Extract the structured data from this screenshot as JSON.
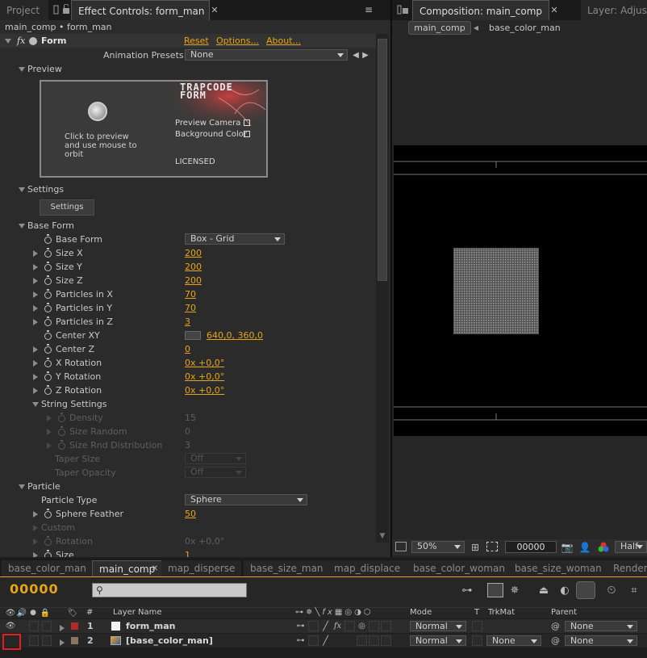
{
  "tabs_top": {
    "project": "Project",
    "effect_controls": "Effect Controls: form_man",
    "composition": "Composition: main_comp",
    "layer": "Layer: Adjustm"
  },
  "effect": {
    "breadcrumb": "main_comp • form_man",
    "fx_label": "fx",
    "name": "Form",
    "reset": "Reset",
    "options": "Options...",
    "about": "About...",
    "presets_label": "Animation Presets:",
    "presets_value": "None",
    "preview_label": "Preview",
    "preview_text": "Click to preview and use mouse to orbit",
    "logo": "TRAPCODE FORM",
    "preview_camera": "Preview Camera",
    "background_color": "Background Color",
    "licensed": "LICENSED",
    "settings_label": "Settings",
    "settings_button": "Settings",
    "base_form_label": "Base Form",
    "base_form": {
      "label": "Base Form",
      "value": "Box - Grid"
    },
    "size_x": {
      "label": "Size X",
      "value": "200"
    },
    "size_y": {
      "label": "Size Y",
      "value": "200"
    },
    "size_z": {
      "label": "Size Z",
      "value": "200"
    },
    "particles_x": {
      "label": "Particles in X",
      "value": "70"
    },
    "particles_y": {
      "label": "Particles in Y",
      "value": "70"
    },
    "particles_z": {
      "label": "Particles in Z",
      "value": "3"
    },
    "center_xy": {
      "label": "Center XY",
      "value": "640,0, 360,0"
    },
    "center_z": {
      "label": "Center Z",
      "value": "0"
    },
    "x_rotation": {
      "label": "X Rotation",
      "value": "0x +0,0°"
    },
    "y_rotation": {
      "label": "Y Rotation",
      "value": "0x +0,0°"
    },
    "z_rotation": {
      "label": "Z Rotation",
      "value": "0x +0,0°"
    },
    "string_settings": "String Settings",
    "density": {
      "label": "Density",
      "value": "15"
    },
    "size_random": {
      "label": "Size Random",
      "value": "0"
    },
    "size_rnd_dist": {
      "label": "Size Rnd Distribution",
      "value": "3"
    },
    "taper_size": {
      "label": "Taper Size",
      "value": "Off"
    },
    "taper_opacity": {
      "label": "Taper Opacity",
      "value": "Off"
    },
    "particle_label": "Particle",
    "particle_type": {
      "label": "Particle Type",
      "value": "Sphere"
    },
    "sphere_feather": {
      "label": "Sphere Feather",
      "value": "50"
    },
    "custom": "Custom",
    "rotation": {
      "label": "Rotation",
      "value": "0x +0,0°"
    },
    "size": {
      "label": "Size",
      "value": "1"
    }
  },
  "composition": {
    "crumb_main": "main_comp",
    "crumb_base": "base_color_man",
    "zoom": "50%",
    "timecode": "00000",
    "resolution": "Half"
  },
  "timeline": {
    "tabs": [
      "base_color_man",
      "main_comp",
      "map_disperse",
      "base_size_man",
      "map_displace",
      "base_color_woman",
      "base_size_woman",
      "Render"
    ],
    "timecode": "00000",
    "search_placeholder": "",
    "col_num": "#",
    "col_layer_name": "Layer Name",
    "col_mode": "Mode",
    "col_t": "T",
    "col_trkmat": "TrkMat",
    "col_parent": "Parent",
    "layers": [
      {
        "num": "1",
        "name": "form_man",
        "mode": "Normal",
        "trkmat": "",
        "parent": "None",
        "color": "#b02a2a"
      },
      {
        "num": "2",
        "name": "[base_color_man]",
        "mode": "Normal",
        "trkmat": "None",
        "parent": "None",
        "color": "#8a7560"
      }
    ]
  }
}
